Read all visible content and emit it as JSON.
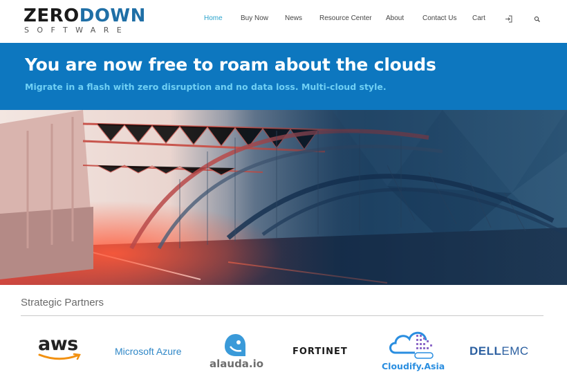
{
  "logo": {
    "word1": "ZERO",
    "word2": "DOWN",
    "sub": "SOFTWARE"
  },
  "nav": {
    "items": [
      {
        "label": "Home",
        "active": true
      },
      {
        "label": "Buy Now",
        "active": false
      },
      {
        "label": "News",
        "active": false
      },
      {
        "label": "Resource Center",
        "active": false
      },
      {
        "label": "About",
        "active": false
      },
      {
        "label": "Contact Us",
        "active": false
      },
      {
        "label": "Cart",
        "active": false
      }
    ],
    "icons": [
      "login-icon",
      "search-icon"
    ]
  },
  "hero": {
    "title": "You are now free to roam about the clouds",
    "subtitle": "Migrate in a flash with zero disruption and no data loss. Multi-cloud style."
  },
  "partners": {
    "heading": "Strategic Partners",
    "logos": [
      {
        "name": "aws",
        "text": "aws"
      },
      {
        "name": "microsoft-azure",
        "text": "Microsoft Azure"
      },
      {
        "name": "alauda",
        "text": "alauda.io"
      },
      {
        "name": "fortinet",
        "text": "FORTINET"
      },
      {
        "name": "cloudify-asia",
        "text": "Cloudify.Asia"
      },
      {
        "name": "dell-emc",
        "word1": "DELL",
        "word2": "EMC"
      }
    ]
  },
  "colors": {
    "brand_blue": "#0d77bf",
    "subtitle_cyan": "#6fd0f5",
    "nav_active": "#2aa3cc",
    "aws_orange": "#f29111",
    "azure_blue": "#2f87c7",
    "fortinet_red": "#da291c",
    "cloudify_blue": "#2a8ee0",
    "dell_blue": "#2b5fa0"
  }
}
